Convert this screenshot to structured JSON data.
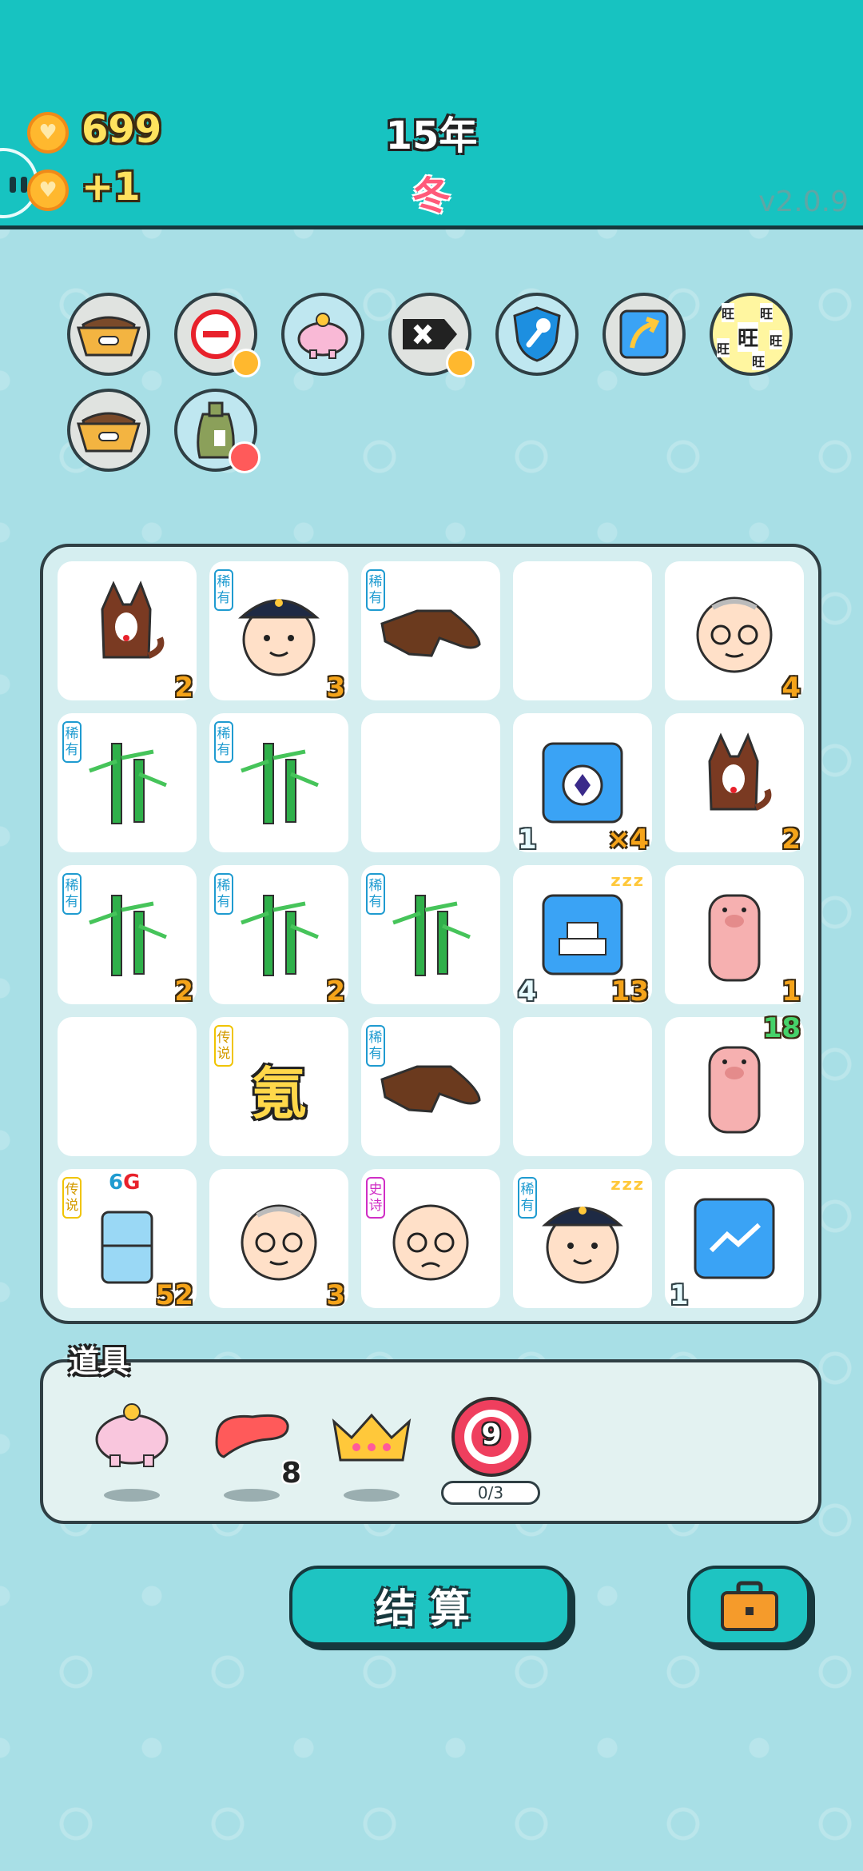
{
  "header": {
    "coins": "699",
    "income": "+1",
    "year": "15年",
    "season": "冬",
    "version": "v2.0.9"
  },
  "relics": [
    {
      "icon": "dog-bowl-icon"
    },
    {
      "icon": "minus-circle-icon"
    },
    {
      "icon": "piggy-bank-icon"
    },
    {
      "icon": "delete-tag-icon"
    },
    {
      "icon": "shield-wrench-icon"
    },
    {
      "icon": "upgrade-arrow-icon"
    },
    {
      "icon": "wang-charm-icon",
      "text": "旺"
    },
    {
      "icon": "dog-bowl-icon"
    },
    {
      "icon": "seed-bag-icon"
    }
  ],
  "board": {
    "tags": {
      "rare": "稀有",
      "legend": "传说",
      "epic": "史诗"
    },
    "cells": [
      {
        "item": "husky",
        "count": "2"
      },
      {
        "item": "police",
        "tag": "rare",
        "count": "3"
      },
      {
        "item": "pointing-hand",
        "tag": "rare"
      },
      {
        "item": "empty"
      },
      {
        "item": "grandpa",
        "count": "4"
      },
      {
        "item": "bamboo",
        "tag": "rare"
      },
      {
        "item": "bamboo",
        "tag": "rare"
      },
      {
        "item": "empty"
      },
      {
        "item": "stopwatch-card",
        "left_count": "1",
        "count": "×4"
      },
      {
        "item": "husky",
        "count": "2"
      },
      {
        "item": "bamboo",
        "tag": "rare",
        "count": "2"
      },
      {
        "item": "bamboo",
        "tag": "rare",
        "count": "2"
      },
      {
        "item": "bamboo",
        "tag": "rare"
      },
      {
        "item": "gold-bars-card",
        "left_count": "4",
        "count": "13",
        "sleeping": true
      },
      {
        "item": "pig",
        "count": "1"
      },
      {
        "item": "empty"
      },
      {
        "item": "krypton",
        "tag": "legend",
        "text": "氪"
      },
      {
        "item": "pointing-hand",
        "tag": "rare"
      },
      {
        "item": "empty"
      },
      {
        "item": "pig",
        "top_count": "18"
      },
      {
        "item": "fridge",
        "tag": "legend",
        "count": "52",
        "badge_num": "6",
        "badge_g": "G"
      },
      {
        "item": "grandpa",
        "count": "3"
      },
      {
        "item": "old-man-worried",
        "tag": "epic"
      },
      {
        "item": "police",
        "tag": "rare",
        "sleeping": true
      },
      {
        "item": "trend-card",
        "left_count": "1"
      }
    ]
  },
  "tools": {
    "label": "道具",
    "items": [
      {
        "icon": "piggy-bank-icon"
      },
      {
        "icon": "liver-icon",
        "count": "8"
      },
      {
        "icon": "crown-icon"
      },
      {
        "icon": "target-icon",
        "number": "9",
        "progress": "0/3"
      }
    ]
  },
  "buttons": {
    "settle": "结算",
    "bag": "briefcase-icon"
  },
  "colors": {
    "header": "#17c3c1",
    "background": "#a8dfe6",
    "coin": "#ffb82e",
    "rare": "#1f9bd0",
    "legend": "#f0c400",
    "epic": "#d02ec5"
  }
}
